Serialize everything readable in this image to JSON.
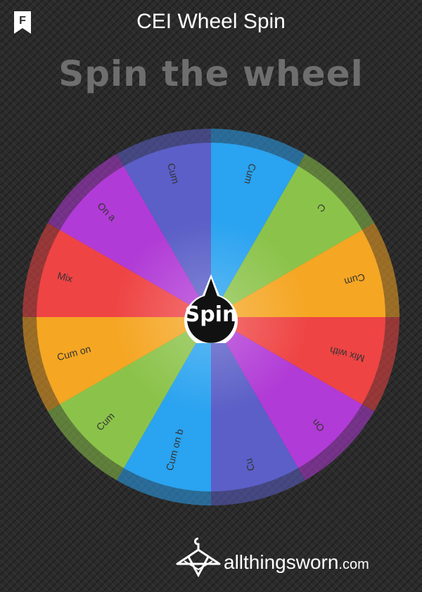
{
  "header": {
    "title": "CEI Wheel Spin",
    "bookmark_letter": "F"
  },
  "heading": "Spin the wheel",
  "wheel": {
    "center_button": "Spin",
    "segments": [
      {
        "label": "Cum",
        "color": "#2aa3f0"
      },
      {
        "label": "C",
        "color": "#8bc34a"
      },
      {
        "label": "Cum",
        "color": "#f5a623"
      },
      {
        "label": "Mix with",
        "color": "#ef4444"
      },
      {
        "label": "On",
        "color": "#b13bd6"
      },
      {
        "label": "Cu",
        "color": "#5b5fc7"
      },
      {
        "label": "Cum on b",
        "color": "#2aa3f0"
      },
      {
        "label": "Cum",
        "color": "#8bc34a"
      },
      {
        "label": "Cum on",
        "color": "#f5a623"
      },
      {
        "label": "Mix",
        "color": "#ef4444"
      },
      {
        "label": "On a",
        "color": "#b13bd6"
      },
      {
        "label": "Cum",
        "color": "#5b5fc7"
      }
    ]
  },
  "footer": {
    "brand": "allthingsworn",
    "domain": ".com"
  }
}
